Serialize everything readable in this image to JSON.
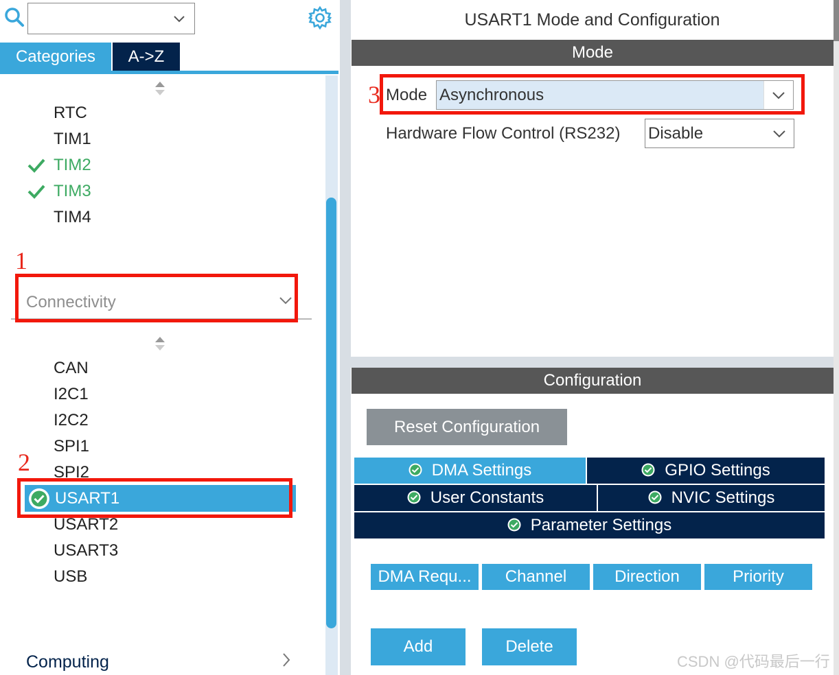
{
  "left_panel": {
    "search_value": "",
    "tabs": {
      "categories": "Categories",
      "az": "A->Z"
    },
    "timers": [
      {
        "label": "RTC",
        "checked": false
      },
      {
        "label": "TIM1",
        "checked": false
      },
      {
        "label": "TIM2",
        "checked": true
      },
      {
        "label": "TIM3",
        "checked": true
      },
      {
        "label": "TIM4",
        "checked": false
      }
    ],
    "connectivity_header": "Connectivity",
    "connectivity_items": [
      {
        "label": "CAN"
      },
      {
        "label": "I2C1"
      },
      {
        "label": "I2C2"
      },
      {
        "label": "SPI1"
      },
      {
        "label": "SPI2"
      },
      {
        "label": "USART1",
        "selected": true
      },
      {
        "label": "USART2"
      },
      {
        "label": "USART3"
      },
      {
        "label": "USB"
      }
    ],
    "computing_header": "Computing"
  },
  "annotations": {
    "one": "1",
    "two": "2",
    "three": "3"
  },
  "right_panel": {
    "title": "USART1 Mode and Configuration",
    "mode_bar": "Mode",
    "mode": {
      "label": "Mode",
      "value": "Asynchronous"
    },
    "hardware_flow": {
      "label": "Hardware Flow Control (RS232)",
      "value": "Disable"
    },
    "config_bar": "Configuration",
    "reset_button": "Reset Configuration",
    "config_tabs": {
      "dma": "DMA Settings",
      "gpio": "GPIO Settings",
      "user_constants": "User Constants",
      "nvic": "NVIC Settings",
      "parameter": "Parameter Settings"
    },
    "dma_table_headers": [
      "DMA Requ...",
      "Channel",
      "Direction",
      "Priority"
    ],
    "add_button": "Add",
    "delete_button": "Delete"
  },
  "watermark": "CSDN @代码最后一行",
  "colors": {
    "accent_blue": "#3aa7db",
    "dark_navy": "#03234b",
    "bar_gray": "#575757",
    "check_green": "#3daa62",
    "annotation_red": "#f2180c"
  }
}
